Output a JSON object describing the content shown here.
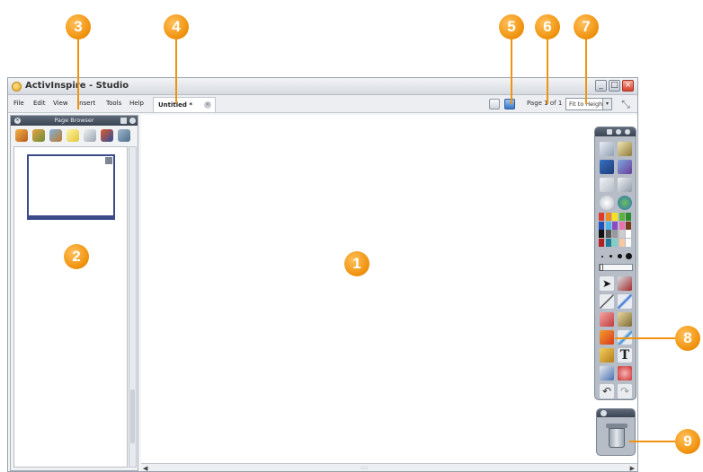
{
  "window": {
    "title": "ActivInspire - Studio",
    "minimize": "_",
    "maximize": "□",
    "close": "×"
  },
  "menu": [
    "File",
    "Edit",
    "View",
    "Insert",
    "Tools",
    "Help"
  ],
  "document_tab": {
    "label": "Untitled *",
    "close": "×"
  },
  "page_indicator": "Page 1 of 1",
  "zoom": {
    "value": "Fit to Height",
    "arrow": "▾"
  },
  "page_browser": {
    "title": "Page Browser",
    "close": "×"
  },
  "scrollbar": {
    "left": "◀",
    "right": "▶",
    "grip": "::::"
  },
  "callouts": [
    "1",
    "2",
    "3",
    "4",
    "5",
    "6",
    "7",
    "8",
    "9"
  ],
  "colors": {
    "callout": "#f0930f",
    "palette": [
      "#e03a2a",
      "#ef8a1d",
      "#f4e21e",
      "#5bb23d",
      "#2d8a2e",
      "#1f4fb7",
      "#4fb4e8",
      "#8b4cc2",
      "#e873b3",
      "#7a3b1d",
      "#111111",
      "#555555",
      "#999999",
      "#cccccc",
      "#ffffff",
      "#b22222",
      "#1e7b9a",
      "#7fd0c3",
      "#f7c8a0",
      "#fafafa"
    ]
  },
  "icons": {
    "fullscreen": "⤡",
    "page_browser_tools": [
      "page-browser-icon",
      "resource-browser-icon",
      "object-browser-icon",
      "notes-browser-icon",
      "property-browser-icon",
      "action-browser-icon",
      "voting-browser-icon"
    ],
    "toolbox": [
      "main-menu-icon",
      "page-browser-toggle-icon",
      "desktop-annotate-icon",
      "resource-icon",
      "previous-page-icon",
      "next-page-icon",
      "reset-page-icon",
      "web-browser-icon",
      "select-icon",
      "tools-icon",
      "pen-icon",
      "highlighter-icon",
      "eraser-icon",
      "magic-ink-icon",
      "fill-icon",
      "shape-icon",
      "connector-icon",
      "text-icon",
      "clear-icon",
      "revert-icon",
      "undo-icon",
      "redo-icon"
    ],
    "text_tool": "T",
    "undo": "↶",
    "redo": "↷"
  }
}
